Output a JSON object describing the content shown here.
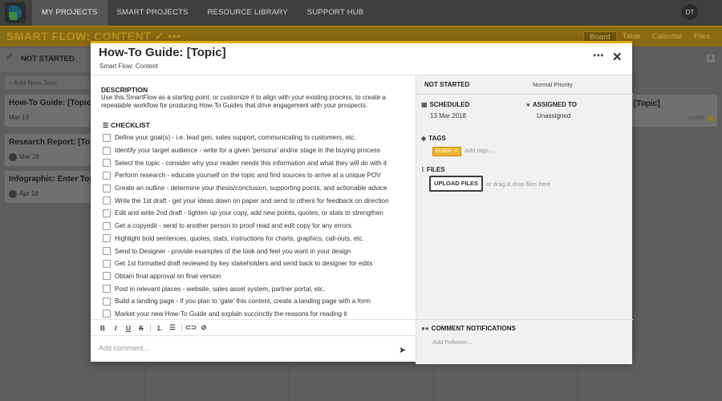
{
  "nav": {
    "items": [
      "MY PROJECTS",
      "SMART PROJECTS",
      "RESOURCE LIBRARY",
      "SUPPORT HUB"
    ],
    "avatar_initials": "DT"
  },
  "flow": {
    "title": "SMART FLOW: CONTENT ✓  •••",
    "views": [
      "Board",
      "Table",
      "Calendar",
      "Files"
    ]
  },
  "background": {
    "column_title": "NOT STARTED",
    "add_task": "+ Add New Task",
    "cards": [
      {
        "title": "How-To Guide: [Topic]",
        "date": "Mar 13"
      },
      {
        "title": "Research Report: [Topic",
        "date": "Mar 29"
      },
      {
        "title": "Infographic: Enter Topic",
        "date": "Apr 18"
      }
    ],
    "right_card_title": "[Topic]",
    "right_card_tag": "GUIDE",
    "right_badge": "1"
  },
  "modal": {
    "title": "How-To Guide: [Topic]",
    "subtitle": "Smart Flow: Content",
    "more_label": "•••",
    "close_label": "✕",
    "description_heading": "DESCRIPTION",
    "description_text": "Use this SmartFlow as a starting point, or customize it to align with your existing process, to create a repeatable workflow for producing How-To Guides that drive engagement with your prospects.",
    "checklist_heading": "CHECKLIST",
    "checklist": [
      "Define your goal(s) - i.e. lead gen, sales support, communicating to customers, etc.",
      "Identify your target audience - write for a given 'persona' and/or stage in the buying process",
      "Select the topic - consider why your reader needs this information and what they will do with it",
      "Perform research - educate yourself on the topic and find sources to arrive at a unique POV",
      "Create an outline - determine your thesis/conclusion, supporting points, and actionable advice",
      "Write the 1st draft - get your ideas down on paper and send to others for feedback on direction",
      "Edit and write 2nd draft - tighten up your copy, add new points, quotes, or stats to strengthen",
      "Get a copyedit - send to another person to proof read and edit copy for any errors",
      "Highlight bold sentences, quotes, stats, instructions for charts, graphics, call-outs, etc.",
      "Send to Designer - provide examples of the look and feel you want in your design",
      "Get 1st formatted draft reviewed by key stakeholders and send back to designer for edits",
      "Obtain final approval on final version",
      "Post in relevant places - website, sales asset system, partner portal, etc.",
      "Build a landing page - if you plan to 'gate' this content, create a landing page with a form",
      "Market your new How-To Guide and explain succinctly the reasons for reading it"
    ],
    "toolbar": [
      "B",
      "I",
      "U",
      "S"
    ],
    "comment_placeholder": "Add comment...",
    "status": "NOT STARTED",
    "priority": "Normal Priority",
    "scheduled_label": "SCHEDULED",
    "scheduled_value": "13 Mar 2018",
    "assigned_label": "ASSIGNED TO",
    "assigned_value": "Unassigned",
    "tags_label": "TAGS",
    "tag": "GUIDE",
    "add_tags": "Add tags...",
    "files_label": "FILES",
    "upload_label": "UPLOAD FILES",
    "drop_text": "or drag & drop files here",
    "comment_notifications_label": "COMMENT NOTIFICATIONS",
    "add_follower": "Add Follower..."
  },
  "colors": {
    "accent": "#e5ac16",
    "tag_bg": "#f0b429"
  }
}
